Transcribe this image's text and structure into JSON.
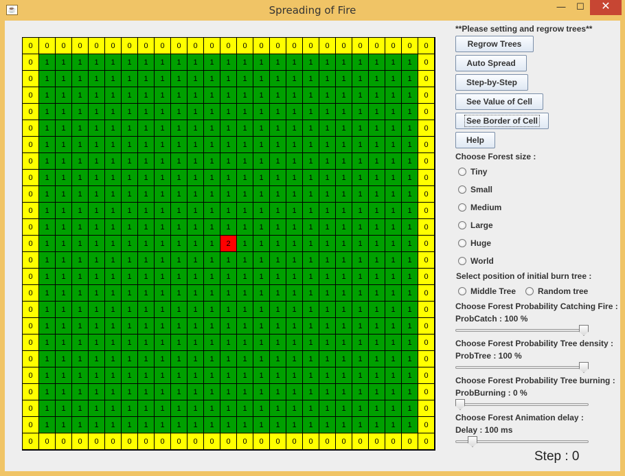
{
  "window": {
    "title": "Spreading of Fire",
    "app_icon": "java-icon",
    "min_glyph": "—",
    "max_glyph": "☐",
    "close_glyph": "✕"
  },
  "grid": {
    "size": 25,
    "burning_cell": {
      "row": 12,
      "col": 12
    },
    "values": {
      "border": "0",
      "tree": "1",
      "burning": "2"
    },
    "colors": {
      "border": "#ffff00",
      "tree": "#00a000",
      "burning": "#ff0000"
    }
  },
  "panel": {
    "heading": "**Please setting and regrow trees**",
    "buttons": {
      "regrow": "Regrow Trees",
      "auto_spread": "Auto Spread",
      "step": "Step-by-Step",
      "see_value": "See Value of Cell",
      "see_border": "See Border of Cell",
      "help": "Help"
    },
    "forest_size_label": "Choose Forest size :",
    "forest_sizes": [
      "Tiny",
      "Small",
      "Medium",
      "Large",
      "Huge",
      "World"
    ],
    "burn_position_label": "Select position of initial burn tree :",
    "burn_positions": [
      "Middle Tree",
      "Random tree"
    ],
    "prob_catch_title": "Choose Forest Probability Catching Fire :",
    "prob_catch_value": "ProbCatch : 100 %",
    "prob_catch_level": 100,
    "prob_tree_title": "Choose Forest Probability Tree density :",
    "prob_tree_value": "ProbTree : 100 %",
    "prob_tree_level": 100,
    "prob_burning_title": "Choose Forest Probability Tree burning :",
    "prob_burning_value": "ProbBurning : 0 %",
    "prob_burning_level": 0,
    "delay_title": "Choose Forest Animation delay :",
    "delay_value": "Delay : 100 ms",
    "delay_level": 0.1,
    "step_text": "Step : 0"
  }
}
